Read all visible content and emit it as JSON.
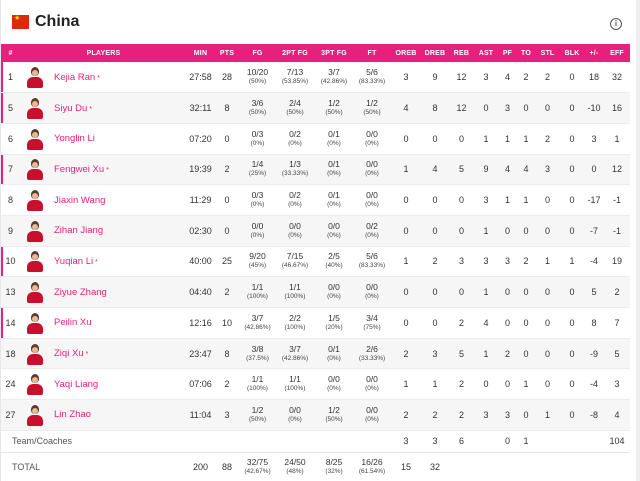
{
  "team": {
    "name": "China",
    "flag_icon": "china-flag-icon",
    "info_icon": "info-icon"
  },
  "colors": {
    "accent": "#e6207c",
    "flag_red": "#de2910",
    "flag_star": "#ffde00"
  },
  "columns": [
    "#",
    "PLAYERS",
    "MIN",
    "PTS",
    "FG",
    "2PT FG",
    "3PT FG",
    "FT",
    "OREB",
    "DREB",
    "REB",
    "AST",
    "PF",
    "TO",
    "STL",
    "BLK",
    "+/-",
    "EFF"
  ],
  "players": [
    {
      "num": "1",
      "name": "Kejia Ran",
      "star": " *",
      "starter": true,
      "min": "27:58",
      "pts": "28",
      "fg": "10/20",
      "fg_pct": "(50%)",
      "fg2": "7/13",
      "fg2_pct": "(53.85%)",
      "fg3": "3/7",
      "fg3_pct": "(42.86%)",
      "ft": "5/6",
      "ft_pct": "(83.33%)",
      "oreb": "3",
      "dreb": "9",
      "reb": "12",
      "ast": "3",
      "pf": "4",
      "to": "2",
      "stl": "2",
      "blk": "0",
      "pm": "18",
      "eff": "32"
    },
    {
      "num": "5",
      "name": "Siyu Du",
      "star": " *",
      "starter": true,
      "min": "32:11",
      "pts": "8",
      "fg": "3/6",
      "fg_pct": "(50%)",
      "fg2": "2/4",
      "fg2_pct": "(50%)",
      "fg3": "1/2",
      "fg3_pct": "(50%)",
      "ft": "1/2",
      "ft_pct": "(50%)",
      "oreb": "4",
      "dreb": "8",
      "reb": "12",
      "ast": "0",
      "pf": "3",
      "to": "0",
      "stl": "0",
      "blk": "0",
      "pm": "-10",
      "eff": "16"
    },
    {
      "num": "6",
      "name": "Yonglin Li",
      "star": "",
      "starter": false,
      "min": "07:20",
      "pts": "0",
      "fg": "0/3",
      "fg_pct": "(0%)",
      "fg2": "0/2",
      "fg2_pct": "(0%)",
      "fg3": "0/1",
      "fg3_pct": "(0%)",
      "ft": "0/0",
      "ft_pct": "(0%)",
      "oreb": "0",
      "dreb": "0",
      "reb": "0",
      "ast": "1",
      "pf": "1",
      "to": "1",
      "stl": "2",
      "blk": "0",
      "pm": "3",
      "eff": "1"
    },
    {
      "num": "7",
      "name": "Fengwei Xu",
      "star": " *",
      "starter": true,
      "min": "19:39",
      "pts": "2",
      "fg": "1/4",
      "fg_pct": "(25%)",
      "fg2": "1/3",
      "fg2_pct": "(33.33%)",
      "fg3": "0/1",
      "fg3_pct": "(0%)",
      "ft": "0/0",
      "ft_pct": "(0%)",
      "oreb": "1",
      "dreb": "4",
      "reb": "5",
      "ast": "9",
      "pf": "4",
      "to": "4",
      "stl": "3",
      "blk": "0",
      "pm": "0",
      "eff": "12"
    },
    {
      "num": "8",
      "name": "Jiaxin Wang",
      "star": "",
      "starter": false,
      "min": "11:29",
      "pts": "0",
      "fg": "0/3",
      "fg_pct": "(0%)",
      "fg2": "0/2",
      "fg2_pct": "(0%)",
      "fg3": "0/1",
      "fg3_pct": "(0%)",
      "ft": "0/0",
      "ft_pct": "(0%)",
      "oreb": "0",
      "dreb": "0",
      "reb": "0",
      "ast": "3",
      "pf": "1",
      "to": "1",
      "stl": "0",
      "blk": "0",
      "pm": "-17",
      "eff": "-1"
    },
    {
      "num": "9",
      "name": "Zihan Jiang",
      "star": "",
      "starter": false,
      "min": "02:30",
      "pts": "0",
      "fg": "0/0",
      "fg_pct": "(0%)",
      "fg2": "0/0",
      "fg2_pct": "(0%)",
      "fg3": "0/0",
      "fg3_pct": "(0%)",
      "ft": "0/2",
      "ft_pct": "(0%)",
      "oreb": "0",
      "dreb": "0",
      "reb": "0",
      "ast": "1",
      "pf": "0",
      "to": "0",
      "stl": "0",
      "blk": "0",
      "pm": "-7",
      "eff": "-1"
    },
    {
      "num": "10",
      "name": "Yuqian Li",
      "star": " *",
      "starter": true,
      "min": "40:00",
      "pts": "25",
      "fg": "9/20",
      "fg_pct": "(45%)",
      "fg2": "7/15",
      "fg2_pct": "(46.67%)",
      "fg3": "2/5",
      "fg3_pct": "(40%)",
      "ft": "5/6",
      "ft_pct": "(83.33%)",
      "oreb": "1",
      "dreb": "2",
      "reb": "3",
      "ast": "3",
      "pf": "3",
      "to": "2",
      "stl": "1",
      "blk": "1",
      "pm": "-4",
      "eff": "19"
    },
    {
      "num": "13",
      "name": "Ziyue Zhang",
      "star": "",
      "starter": false,
      "min": "04:40",
      "pts": "2",
      "fg": "1/1",
      "fg_pct": "(100%)",
      "fg2": "1/1",
      "fg2_pct": "(100%)",
      "fg3": "0/0",
      "fg3_pct": "(0%)",
      "ft": "0/0",
      "ft_pct": "(0%)",
      "oreb": "0",
      "dreb": "0",
      "reb": "0",
      "ast": "1",
      "pf": "0",
      "to": "0",
      "stl": "0",
      "blk": "0",
      "pm": "5",
      "eff": "2"
    },
    {
      "num": "14",
      "name": "Peilin Xu",
      "star": "",
      "starter": true,
      "min": "12:16",
      "pts": "10",
      "fg": "3/7",
      "fg_pct": "(42.86%)",
      "fg2": "2/2",
      "fg2_pct": "(100%)",
      "fg3": "1/5",
      "fg3_pct": "(20%)",
      "ft": "3/4",
      "ft_pct": "(75%)",
      "oreb": "0",
      "dreb": "0",
      "reb": "2",
      "ast": "4",
      "pf": "0",
      "to": "0",
      "stl": "0",
      "blk": "0",
      "pm": "8",
      "eff": "7"
    },
    {
      "num": "18",
      "name": "Ziqi Xu",
      "star": " *",
      "starter": false,
      "min": "23:47",
      "pts": "8",
      "fg": "3/8",
      "fg_pct": "(37.5%)",
      "fg2": "3/7",
      "fg2_pct": "(42.86%)",
      "fg3": "0/1",
      "fg3_pct": "(0%)",
      "ft": "2/6",
      "ft_pct": "(33.33%)",
      "oreb": "2",
      "dreb": "3",
      "reb": "5",
      "ast": "1",
      "pf": "2",
      "to": "0",
      "stl": "0",
      "blk": "0",
      "pm": "-9",
      "eff": "5"
    },
    {
      "num": "24",
      "name": "Yaqi Liang",
      "star": "",
      "starter": false,
      "min": "07:06",
      "pts": "2",
      "fg": "1/1",
      "fg_pct": "(100%)",
      "fg2": "1/1",
      "fg2_pct": "(100%)",
      "fg3": "0/0",
      "fg3_pct": "(0%)",
      "ft": "0/0",
      "ft_pct": "(0%)",
      "oreb": "1",
      "dreb": "1",
      "reb": "2",
      "ast": "0",
      "pf": "0",
      "to": "1",
      "stl": "0",
      "blk": "0",
      "pm": "-4",
      "eff": "3"
    },
    {
      "num": "27",
      "name": "Lin Zhao",
      "star": "",
      "starter": false,
      "min": "11:04",
      "pts": "3",
      "fg": "1/2",
      "fg_pct": "(50%)",
      "fg2": "0/0",
      "fg2_pct": "(0%)",
      "fg3": "1/2",
      "fg3_pct": "(50%)",
      "ft": "0/0",
      "ft_pct": "(0%)",
      "oreb": "2",
      "dreb": "2",
      "reb": "2",
      "ast": "3",
      "pf": "3",
      "to": "0",
      "stl": "1",
      "blk": "0",
      "pm": "-8",
      "eff": "4"
    }
  ],
  "coaches": {
    "label": "Team/Coaches",
    "oreb": "3",
    "dreb": "3",
    "reb": "6",
    "ast": "",
    "pf": "0",
    "to": "1",
    "stl": "",
    "blk": "",
    "pm": "",
    "eff": "104"
  },
  "total": {
    "label": "TOTAL",
    "min": "200",
    "pts": "88",
    "fg": "32/75",
    "fg_pct": "(42.67%)",
    "fg2": "24/50",
    "fg2_pct": "(48%)",
    "fg3": "8/25",
    "fg3_pct": "(32%)",
    "ft": "16/26",
    "ft_pct": "(61.54%)",
    "oreb": "15",
    "dreb": "32"
  }
}
